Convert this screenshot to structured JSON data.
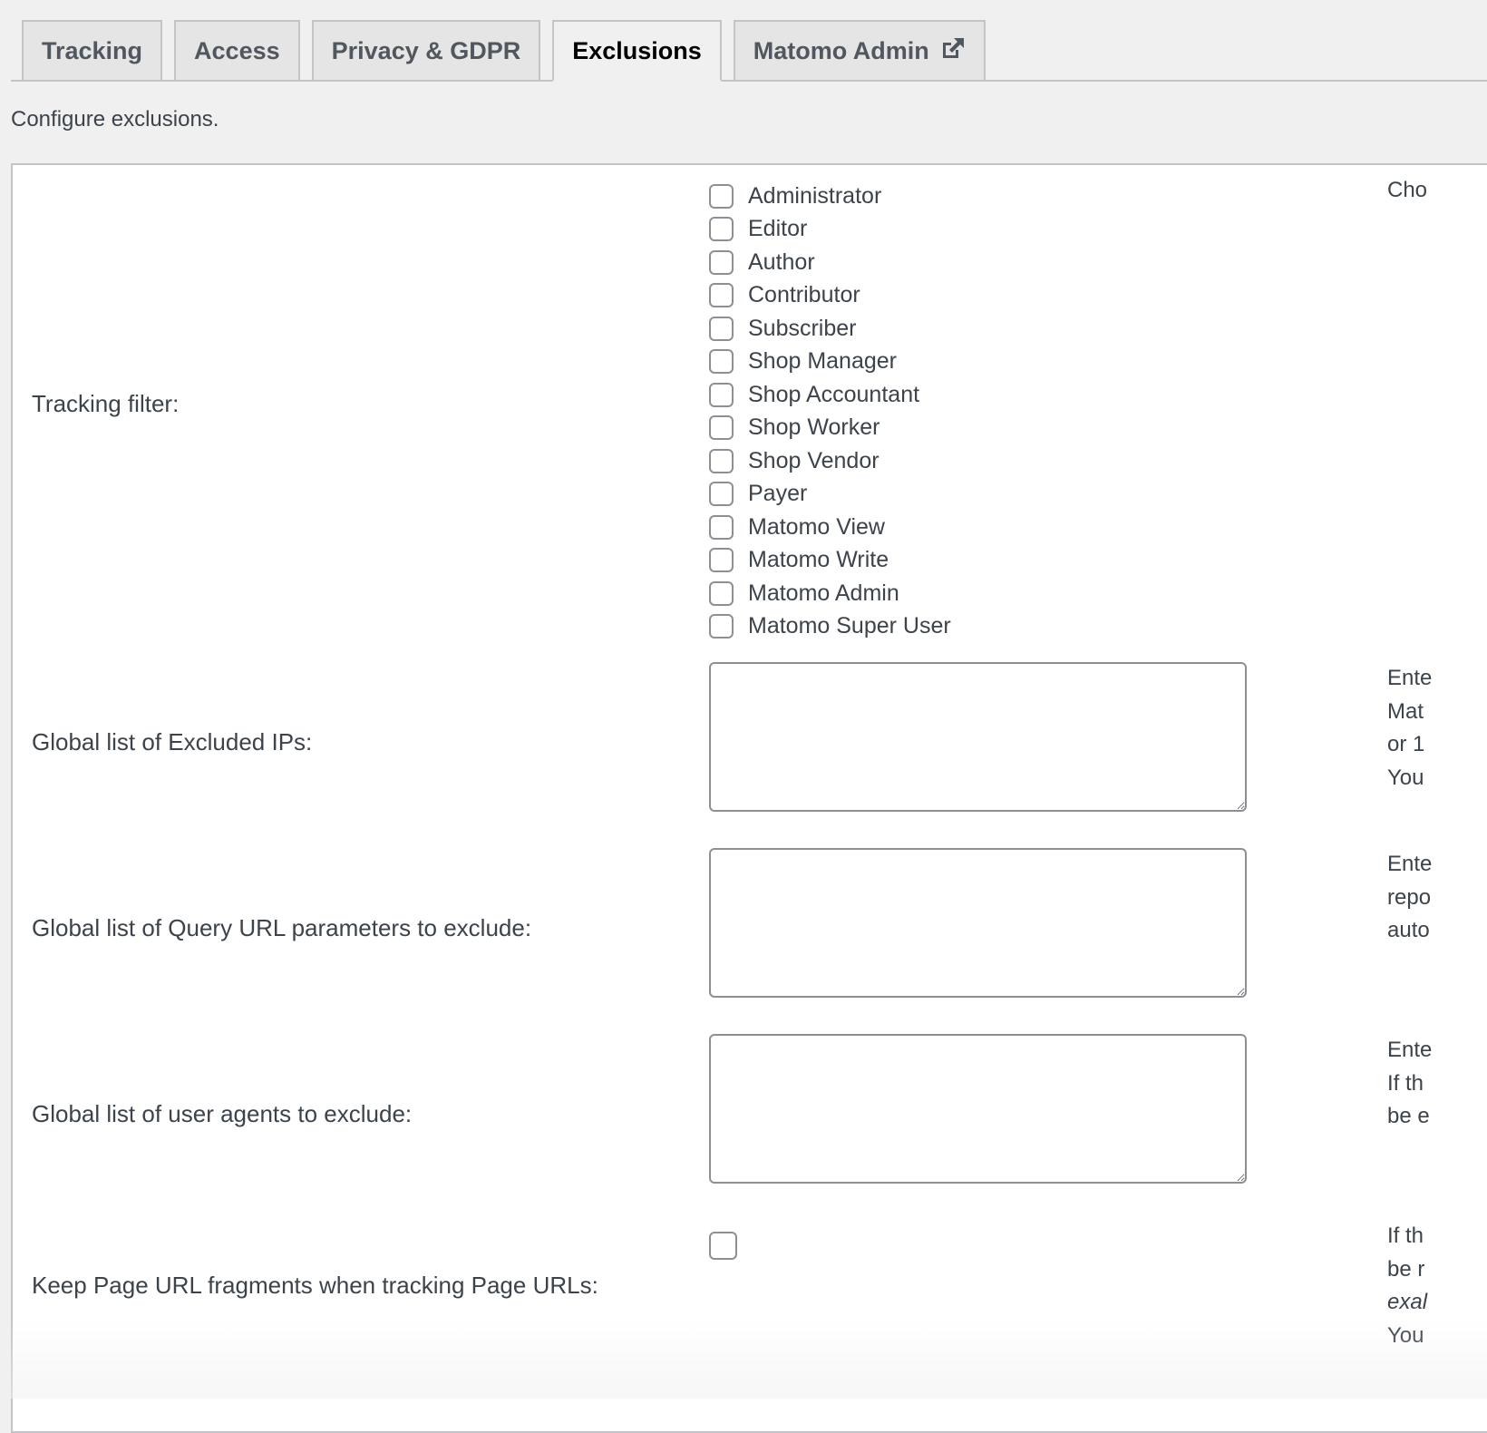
{
  "tabs": [
    {
      "label": "Tracking",
      "active": false
    },
    {
      "label": "Access",
      "active": false
    },
    {
      "label": "Privacy & GDPR",
      "active": false
    },
    {
      "label": "Exclusions",
      "active": true
    },
    {
      "label": "Matomo Admin",
      "active": false,
      "icon": "external-link-icon"
    }
  ],
  "intro": "Configure exclusions.",
  "tracking_filter": {
    "label": "Tracking filter:",
    "description": "Cho",
    "roles": [
      {
        "label": "Administrator",
        "checked": false
      },
      {
        "label": "Editor",
        "checked": false
      },
      {
        "label": "Author",
        "checked": false
      },
      {
        "label": "Contributor",
        "checked": false
      },
      {
        "label": "Subscriber",
        "checked": false
      },
      {
        "label": "Shop Manager",
        "checked": false
      },
      {
        "label": "Shop Accountant",
        "checked": false
      },
      {
        "label": "Shop Worker",
        "checked": false
      },
      {
        "label": "Shop Vendor",
        "checked": false
      },
      {
        "label": "Payer",
        "checked": false
      },
      {
        "label": "Matomo View",
        "checked": false
      },
      {
        "label": "Matomo Write",
        "checked": false
      },
      {
        "label": "Matomo Admin",
        "checked": false
      },
      {
        "label": "Matomo Super User",
        "checked": false
      }
    ]
  },
  "excluded_ips": {
    "label": "Global list of Excluded IPs:",
    "value": "",
    "description_lines": [
      "Ente",
      "Mat",
      "or 1",
      "You"
    ]
  },
  "excluded_params": {
    "label": "Global list of Query URL parameters to exclude:",
    "value": "",
    "description_lines": [
      "Ente",
      "repo",
      "auto"
    ]
  },
  "excluded_useragents": {
    "label": "Global list of user agents to exclude:",
    "value": "",
    "description_lines": [
      "Ente",
      "If th",
      "be e"
    ]
  },
  "keep_fragments": {
    "label": "Keep Page URL fragments when tracking Page URLs:",
    "checked": false,
    "description_lines": [
      "If th",
      "be r",
      "exal",
      "You"
    ]
  }
}
